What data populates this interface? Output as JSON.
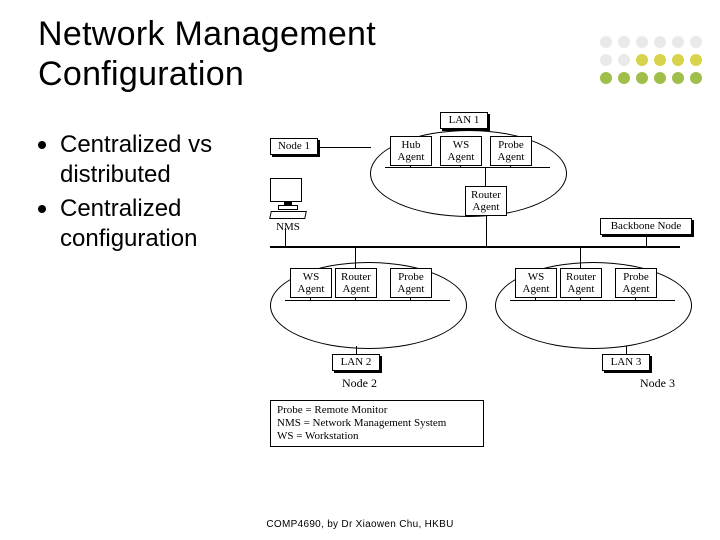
{
  "title_line1": "Network Management",
  "title_line2": "Configuration",
  "bullets": [
    "Centralized vs distributed",
    "Centralized configuration"
  ],
  "dots_colors": {
    "row1": [
      "#e9e9e9",
      "#e9e9e9",
      "#e9e9e9",
      "#e9e9e9",
      "#e9e9e9",
      "#e9e9e9"
    ],
    "row2": [
      "#e9e9e9",
      "#e9e9e9",
      "#d7d34a",
      "#d7d34a",
      "#d7d34a",
      "#d7d34a"
    ],
    "row3": [
      "#9fbf4a",
      "#9fbf4a",
      "#9fbf4a",
      "#9fbf4a",
      "#9fbf4a",
      "#9fbf4a"
    ]
  },
  "diagram": {
    "nms_label": "NMS",
    "lan1": {
      "caption": "LAN 1",
      "node_label": "Node 1",
      "boxes": [
        "Hub\nAgent",
        "WS\nAgent",
        "Probe\nAgent",
        "Router\nAgent"
      ]
    },
    "backbone_label": "Backbone Node",
    "lan2": {
      "caption": "LAN 2",
      "node_label": "Node 2",
      "boxes": [
        "WS\nAgent",
        "Router\nAgent",
        "Probe\nAgent"
      ]
    },
    "lan3": {
      "caption": "LAN 3",
      "node_label": "Node 3",
      "boxes": [
        "WS\nAgent",
        "Router\nAgent",
        "Probe\nAgent"
      ]
    },
    "legend": [
      "Probe = Remote Monitor",
      "NMS = Network Management System",
      "WS = Workstation"
    ]
  },
  "footer": "COMP4690, by Dr Xiaowen Chu,  HKBU"
}
